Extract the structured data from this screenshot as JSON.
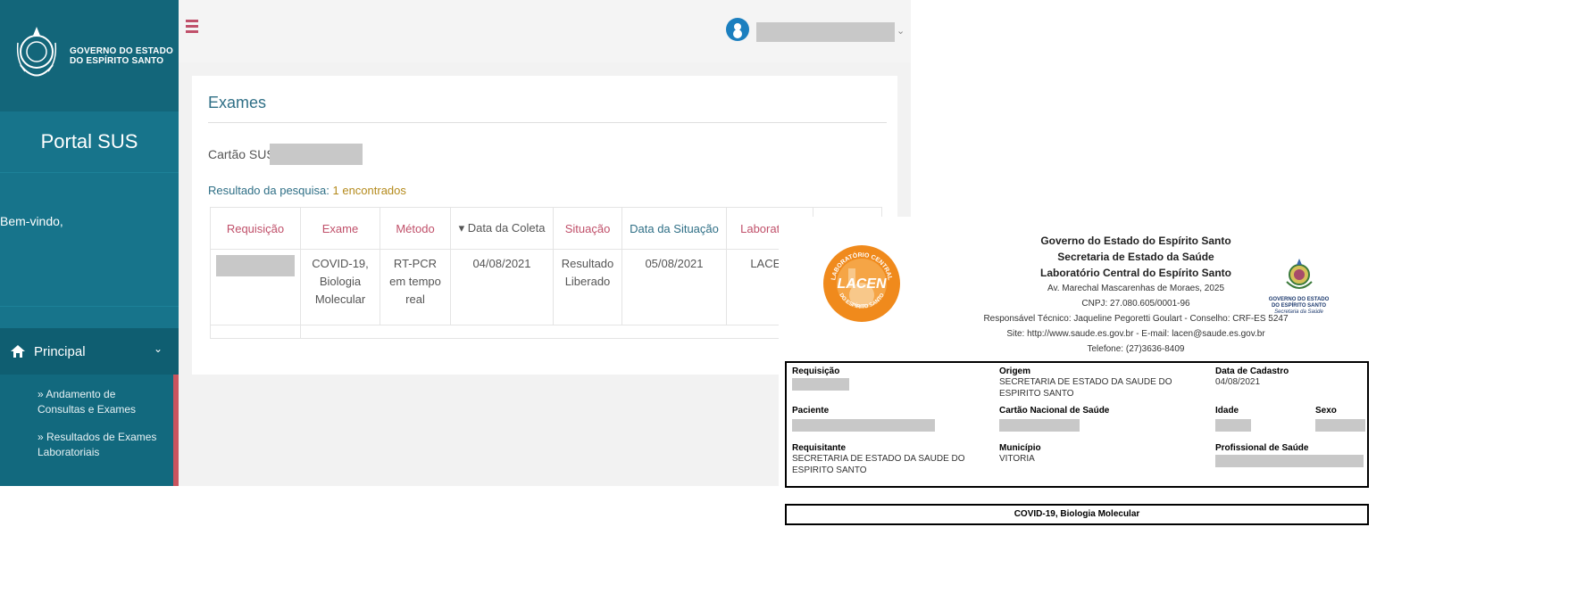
{
  "portal": {
    "brand": {
      "line1": "GOVERNO DO ESTADO",
      "line2": "DO ESPÍRITO SANTO"
    },
    "title": "Portal SUS",
    "welcome": "Bem-vindo,",
    "menu": {
      "principal": "Principal",
      "items": [
        "» Andamento de Consultas e Exames",
        "» Resultados de Exames Laboratoriais"
      ]
    },
    "page": {
      "title": "Exames",
      "cartao_label": "Cartão SUS:",
      "resultado_label": "Resultado da pesquisa:",
      "resultado_count": "1 encontrados"
    },
    "table": {
      "headers": [
        "Requisição",
        "Exame",
        "Método",
        "▾ Data da Coleta",
        "Situação",
        "Data da Situação",
        "Laboratório"
      ],
      "rows": [
        {
          "exame": "COVID-19, Biologia Molecular",
          "metodo": "RT-PCR em tempo real",
          "data_coleta": "04/08/2021",
          "situacao": "Resultado Liberado",
          "data_situacao": "05/08/2021",
          "laboratorio": "LACEN"
        }
      ]
    },
    "colors": {
      "sidebar": "#17748b",
      "accent_red": "#c0506a",
      "accent_blue": "#2f6f86"
    }
  },
  "report": {
    "header": {
      "line1": "Governo do Estado do Espírito Santo",
      "line2": "Secretaria de Estado da Saúde",
      "line3": "Laboratório Central do Espírito Santo",
      "address": "Av. Marechal Mascarenhas de Moraes, 2025",
      "cnpj": "CNPJ: 27.080.605/0001-96",
      "responsavel": "Responsável Técnico: Jaqueline Pegoretti Goulart - Conselho: CRF-ES 5247",
      "site": "Site: http://www.saude.es.gov.br - E-mail: lacen@saude.es.gov.br",
      "telefone": "Telefone: (27)3636-8409"
    },
    "lacen_logo": {
      "arc_top": "LABORATÓRIO CENTRAL",
      "center": "LACEN",
      "arc_bottom": "DO ESPÍRITO SANTO"
    },
    "es_crest": {
      "line1": "GOVERNO DO ESTADO",
      "line2": "DO ESPÍRITO SANTO",
      "line3": "Secretaria da Saúde"
    },
    "fields": {
      "requisicao_label": "Requisição",
      "origem_label": "Origem",
      "origem_value": "SECRETARIA DE ESTADO DA SAUDE DO ESPIRITO SANTO",
      "data_cadastro_label": "Data de Cadastro",
      "data_cadastro_value": "04/08/2021",
      "paciente_label": "Paciente",
      "cartao_label": "Cartão Nacional de Saúde",
      "idade_label": "Idade",
      "sexo_label": "Sexo",
      "requisitante_label": "Requisitante",
      "requisitante_value": "SECRETARIA DE ESTADO DA SAUDE DO ESPIRITO SANTO",
      "municipio_label": "Município",
      "municipio_value": "VITORIA",
      "profissional_label": "Profissional de Saúde"
    },
    "exam_title": "COVID-19, Biologia Molecular"
  }
}
